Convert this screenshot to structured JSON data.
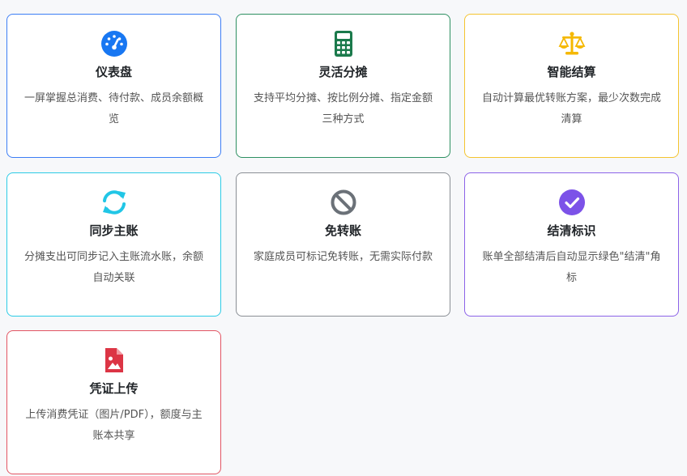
{
  "colors": {
    "dashboard": "#1877f2",
    "split": "#1b7a4c",
    "settle": "#f5b800",
    "sync": "#21c6e6",
    "no_transfer": "#6b7178",
    "settled_mark": "#7c52e8",
    "receipt": "#dc3545"
  },
  "cards": [
    {
      "icon": "speedometer-icon",
      "title": "仪表盘",
      "desc": "一屏掌握总消费、待付款、成员余额概览"
    },
    {
      "icon": "calculator-icon",
      "title": "灵活分摊",
      "desc": "支持平均分摊、按比例分摊、指定金额三种方式"
    },
    {
      "icon": "balance-scale-icon",
      "title": "智能结算",
      "desc": "自动计算最优转账方案，最少次数完成清算"
    },
    {
      "icon": "sync-arrows-icon",
      "title": "同步主账",
      "desc": "分摊支出可同步记入主账流水账，余额自动关联"
    },
    {
      "icon": "ban-icon",
      "title": "免转账",
      "desc": "家庭成员可标记免转账，无需实际付款"
    },
    {
      "icon": "check-circle-icon",
      "title": "结清标识",
      "desc": "账单全部结清后自动显示绿色\"结清\"角标"
    },
    {
      "icon": "image-file-icon",
      "title": "凭证上传",
      "desc": "上传消费凭证（图片/PDF），额度与主账本共享"
    }
  ]
}
